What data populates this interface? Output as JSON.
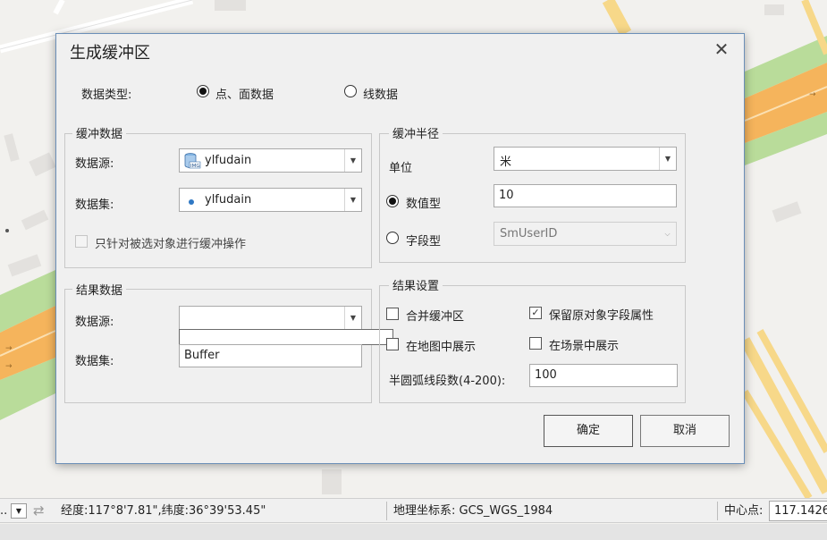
{
  "dialog": {
    "title": "生成缓冲区",
    "close_icon": "close-icon",
    "data_type": {
      "label": "数据类型:",
      "options": [
        {
          "label": "点、面数据",
          "selected": true
        },
        {
          "label": "线数据",
          "selected": false
        }
      ]
    },
    "buffer_data": {
      "title": "缓冲数据",
      "datasource_label": "数据源:",
      "datasource_value": "ylfudain",
      "dataset_label": "数据集:",
      "dataset_value": "ylfudain",
      "selected_only_label": "只针对被选对象进行缓冲操作",
      "selected_only_checked": false
    },
    "buffer_radius": {
      "title": "缓冲半径",
      "unit_label": "单位",
      "unit_value": "米",
      "numeric_label": "数值型",
      "numeric_selected": true,
      "numeric_value": "10",
      "field_label": "字段型",
      "field_selected": false,
      "field_value": "SmUserID"
    },
    "result_data": {
      "title": "结果数据",
      "datasource_label": "数据源:",
      "datasource_value": "",
      "dataset_label": "数据集:",
      "dataset_value": "Buffer"
    },
    "result_settings": {
      "title": "结果设置",
      "merge_label": "合并缓冲区",
      "merge_checked": false,
      "keep_fields_label": "保留原对象字段属性",
      "keep_fields_checked": true,
      "show_in_map_label": "在地图中展示",
      "show_in_map_checked": false,
      "show_in_scene_label": "在场景中展示",
      "show_in_scene_checked": false,
      "arc_segments_label": "半圆弧线段数(4-200):",
      "arc_segments_value": "100"
    },
    "ok_label": "确定",
    "cancel_label": "取消"
  },
  "status_bar": {
    "coords": "经度:117°8'7.81\",纬度:36°39'53.45\"",
    "crs_label": "地理坐标系: GCS_WGS_1984",
    "center_label": "中心点:",
    "center_value": "117.1426"
  },
  "colors": {
    "road_yellow": "#f7d889",
    "road_orange": "#f5b45c",
    "green_strip": "#b9dc9a",
    "dialog_bg": "#f0f0f0",
    "dialog_border": "#6b8fb8"
  }
}
